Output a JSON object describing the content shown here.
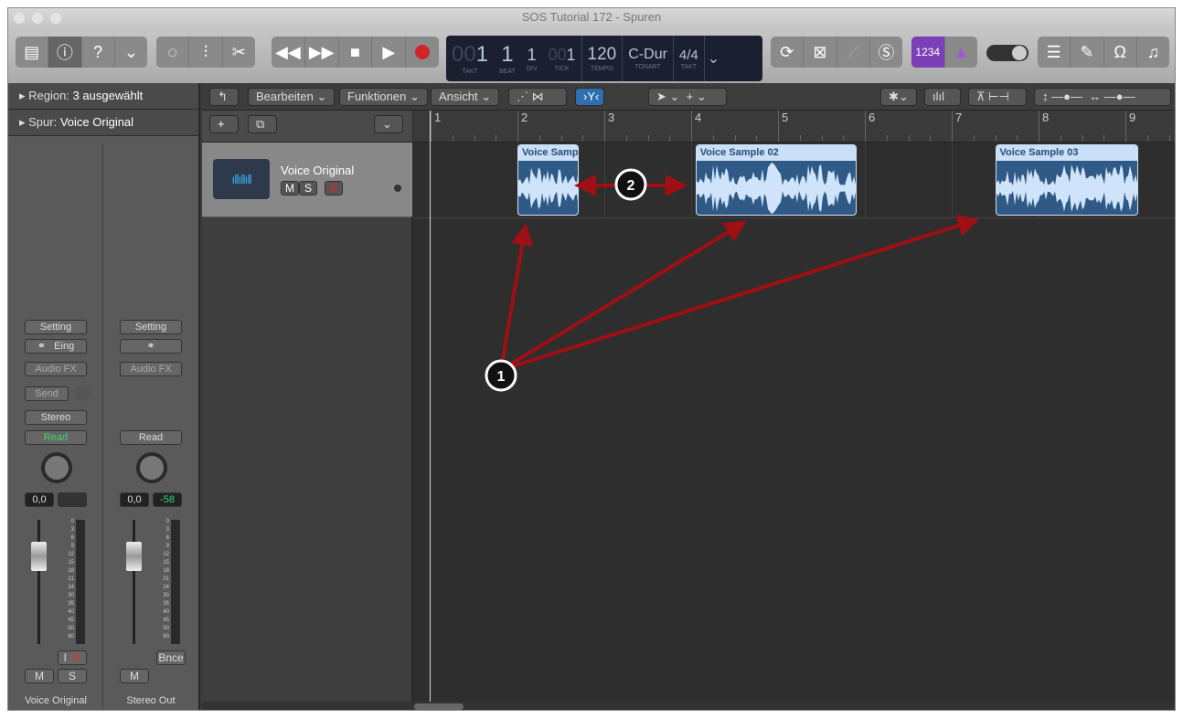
{
  "window": {
    "title": "SOS Tutorial 172 - Spuren"
  },
  "lcd": {
    "takt": "1",
    "takt_prefix": "00",
    "beat": "1",
    "div": "1",
    "tick": "1",
    "tick_prefix": "00",
    "tempo": "120",
    "key": "C-Dur",
    "sig": "4/4",
    "labels": [
      "TAKT",
      "BEAT",
      "DIV",
      "TICK",
      "TEMPO",
      "TONART",
      "TAKT"
    ]
  },
  "toolbar": {
    "count_in": "1234"
  },
  "inspector": {
    "region_label": "Region:",
    "region_value": "3 ausgewählt",
    "track_label": "Spur:",
    "track_value": "Voice Original"
  },
  "strips": [
    {
      "setting": "Setting",
      "input": "Eing",
      "fx": "Audio FX",
      "send": "Send",
      "format": "Stereo",
      "auto": "Read",
      "vol": "0,0",
      "peak": "",
      "i": "I",
      "r": "R",
      "m": "M",
      "s": "S",
      "name": "Voice Original"
    },
    {
      "setting": "Setting",
      "fx": "Audio FX",
      "auto": "Read",
      "vol": "0,0",
      "peak": "-58",
      "bnce": "Bnce",
      "m": "M",
      "name": "Stereo Out"
    }
  ],
  "meter_scale": [
    "0",
    "3",
    "6",
    "9",
    "12",
    "15",
    "18",
    "21",
    "24",
    "30",
    "35",
    "40",
    "45",
    "50",
    "60"
  ],
  "menu": {
    "edit": "Bearbeiten",
    "functions": "Funktionen",
    "view": "Ansicht"
  },
  "track": {
    "name": "Voice Original",
    "m": "M",
    "s": "S",
    "r": "R"
  },
  "ruler": [
    "1",
    "2",
    "3",
    "4",
    "5",
    "6",
    "7",
    "8",
    "9"
  ],
  "regions": [
    {
      "name": "Voice Sample",
      "start": 2.0,
      "end": 2.7
    },
    {
      "name": "Voice Sample 02",
      "start": 4.05,
      "end": 5.9
    },
    {
      "name": "Voice Sample 03",
      "start": 7.5,
      "end": 9.15
    }
  ],
  "annotations": [
    "1",
    "2"
  ],
  "colors": {
    "accent": "#7d3fb8",
    "region": "#2f5a86",
    "arrow": "#a00f14",
    "record": "#d0262b",
    "meter_green": "#3ed46a"
  }
}
